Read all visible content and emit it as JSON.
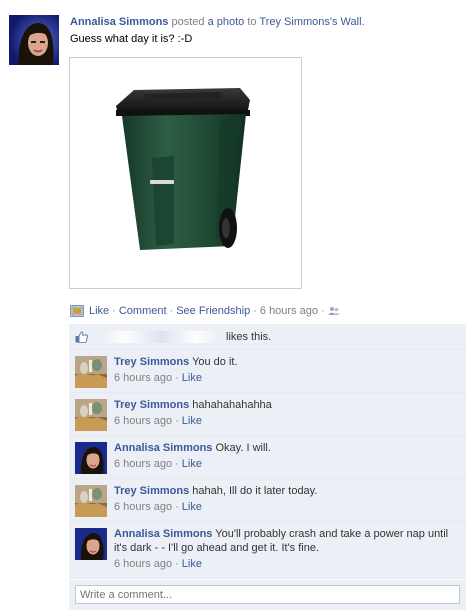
{
  "post": {
    "author": "Annalisa Simmons",
    "verb": "posted",
    "object_link": "a photo",
    "to_word": "to",
    "target": "Trey Simmons",
    "target_suffix": "'s Wall.",
    "message": "Guess what day it is? :-D"
  },
  "actions": {
    "like": "Like",
    "comment": "Comment",
    "see_friendship": "See Friendship",
    "timestamp": "6 hours ago",
    "separator": "·"
  },
  "likes": {
    "text": "likes this."
  },
  "comments": [
    {
      "author": "Trey Simmons",
      "text": "You do it.",
      "time": "6 hours ago",
      "like": "Like",
      "avatar": "trey"
    },
    {
      "author": "Trey Simmons",
      "text": "hahahahahahha",
      "time": "6 hours ago",
      "like": "Like",
      "avatar": "trey"
    },
    {
      "author": "Annalisa Simmons",
      "text": "Okay. I will.",
      "time": "6 hours ago",
      "like": "Like",
      "avatar": "annalisa"
    },
    {
      "author": "Trey Simmons",
      "text": "hahah, Ill do it later today.",
      "time": "6 hours ago",
      "like": "Like",
      "avatar": "trey"
    },
    {
      "author": "Annalisa Simmons",
      "text": "You'll probably crash and take a power nap until it's dark - - I'll go ahead and get it. It's fine.",
      "time": "6 hours ago",
      "like": "Like",
      "avatar": "annalisa"
    }
  ],
  "write_comment": {
    "placeholder": "Write a comment..."
  },
  "colors": {
    "link": "#3b5998",
    "ufi_background": "#eceff5",
    "trash_bin": "#1f4a34"
  },
  "icons": {
    "photo": "photo-icon",
    "thumbs_up": "thumbs-up-icon",
    "privacy": "friends-audience-icon"
  }
}
